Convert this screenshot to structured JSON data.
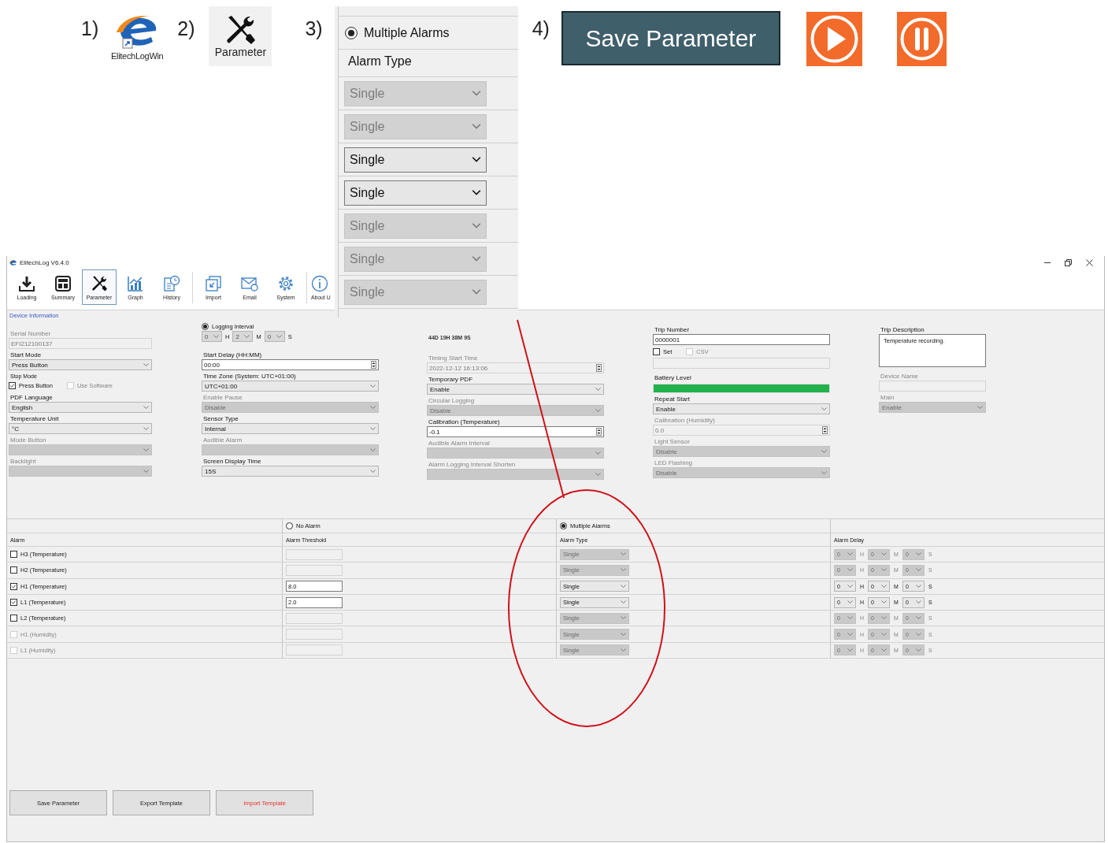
{
  "guide": {
    "steps": [
      {
        "number": "1)",
        "kind": "app",
        "caption": "ElitechLogWin"
      },
      {
        "number": "2)",
        "kind": "parameter",
        "caption": "Parameter"
      },
      {
        "number": "3)",
        "kind": "callout"
      },
      {
        "number": "4)",
        "kind": "buttons"
      }
    ],
    "callout": {
      "option": {
        "label": "Multiple Alarms",
        "selected": true
      },
      "header": "Alarm Type",
      "types": [
        {
          "value": "Single",
          "disabled": true
        },
        {
          "value": "Single",
          "disabled": true
        },
        {
          "value": "Single",
          "disabled": false
        },
        {
          "value": "Single",
          "disabled": false
        },
        {
          "value": "Single",
          "disabled": true
        },
        {
          "value": "Single",
          "disabled": true
        },
        {
          "value": "Single",
          "disabled": true
        }
      ]
    },
    "save_button": "Save Parameter",
    "media_buttons": [
      {
        "kind": "play"
      },
      {
        "kind": "pause"
      }
    ]
  },
  "window": {
    "title": "ElitechLog V6.4.0",
    "toolbar": [
      {
        "label": "Loading",
        "kind": "loading",
        "selected": false
      },
      {
        "label": "Summary",
        "kind": "summary",
        "selected": false
      },
      {
        "label": "Parameter",
        "kind": "parameter",
        "selected": true
      },
      {
        "label": "Graph",
        "kind": "graph",
        "selected": false
      },
      {
        "label": "History",
        "kind": "history",
        "selected": false
      },
      {
        "label": "Import",
        "kind": "import",
        "selected": false
      },
      {
        "label": "Email",
        "kind": "email",
        "selected": false
      },
      {
        "label": "System",
        "kind": "system",
        "selected": false
      },
      {
        "label": "About U",
        "kind": "about",
        "selected": false
      }
    ],
    "section": "Device Information",
    "columns": [
      [
        {
          "kind": "input",
          "label": "Serial Number",
          "value": "EFI212100137",
          "disabled": true
        },
        {
          "kind": "select",
          "label": "Start Mode",
          "value": "Press Button",
          "disabled": false
        },
        {
          "kind": "checks",
          "label": "Stop Mode",
          "items": [
            {
              "label": "Press Button",
              "checked": true,
              "disabled": false
            },
            {
              "label": "Use Software",
              "checked": false,
              "disabled": true
            }
          ]
        },
        {
          "kind": "select",
          "label": "PDF Language",
          "value": "English",
          "disabled": false
        },
        {
          "kind": "select",
          "label": "Temperature Unit",
          "value": "°C",
          "disabled": false
        },
        {
          "kind": "select",
          "label": "Mode Button",
          "disabled": true
        },
        {
          "kind": "select",
          "label": "Backlight",
          "disabled": true
        }
      ],
      [
        {
          "kind": "interval",
          "label": "Logging Interval",
          "selected": true,
          "parts": [
            {
              "value": "0",
              "unit": "H"
            },
            {
              "value": "2",
              "unit": "M"
            },
            {
              "value": "0",
              "unit": "S"
            }
          ]
        },
        {
          "kind": "spin",
          "label": "Start Delay (HH:MM)",
          "value": "00:00",
          "disabled": false
        },
        {
          "kind": "select",
          "label": "Time Zone (System: UTC+01:00)",
          "value": "UTC+01:00",
          "disabled": false
        },
        {
          "kind": "select",
          "label": "Enable Pause",
          "value": "Disable",
          "disabled": true
        },
        {
          "kind": "select",
          "label": "Sensor Type",
          "value": "Internal",
          "disabled": false
        },
        {
          "kind": "select",
          "label": "Audible Alarm",
          "disabled": true
        },
        {
          "kind": "select",
          "label": "Screen Display Time",
          "value": "15S",
          "disabled": false
        }
      ],
      [
        {
          "kind": "note",
          "value": "44D 19H 38M 9S"
        },
        {
          "kind": "spin",
          "label": "Timing Start Time",
          "value": "2022-12-12 16:13:06",
          "disabled": true
        },
        {
          "kind": "select",
          "label": "Temporary PDF",
          "value": "Enable",
          "disabled": false
        },
        {
          "kind": "select",
          "label": "Circular Logging",
          "value": "Disable",
          "disabled": true
        },
        {
          "kind": "spin",
          "label": "Calibration (Temperature)",
          "value": "-0.1",
          "disabled": false
        },
        {
          "kind": "select",
          "label": "Audible Alarm Interval",
          "disabled": true
        },
        {
          "kind": "select",
          "label": "Alarm Logging Interval Shorten",
          "disabled": true
        }
      ],
      [
        {
          "kind": "input",
          "label": "Trip Number",
          "value": "0000001",
          "disabled": false
        },
        {
          "kind": "checks",
          "items": [
            {
              "label": "Set",
              "checked": false,
              "disabled": false
            },
            {
              "label": "CSV",
              "checked": false,
              "disabled": true
            }
          ]
        },
        {
          "kind": "input",
          "disabled": true
        },
        {
          "kind": "battery",
          "label": "Battery Level",
          "level": 1
        },
        {
          "kind": "select",
          "label": "Repeat Start",
          "value": "Enable",
          "disabled": false
        },
        {
          "kind": "spin",
          "label": "Calibration (Humidity)",
          "value": "0.0",
          "disabled": true
        },
        {
          "kind": "select",
          "label": "Light Sensor",
          "value": "Disable",
          "disabled": true
        },
        {
          "kind": "select",
          "label": "LED Flashing",
          "value": "Disable",
          "disabled": true
        }
      ],
      [
        {
          "kind": "textarea",
          "label": "Trip Description",
          "value": "Temperature recording."
        },
        {
          "kind": "input",
          "label": "Device Name",
          "disabled": true
        },
        {
          "kind": "select",
          "label": "Main",
          "value": "Enable",
          "disabled": true
        }
      ]
    ],
    "alarms": {
      "modes": [
        {
          "label": "No Alarm",
          "selected": false
        },
        {
          "label": "Multiple Alarms",
          "selected": true
        }
      ],
      "columns": [
        "Alarm",
        "Alarm Threshold",
        "Alarm Type",
        "Alarm Delay"
      ],
      "rows": [
        {
          "name": "H3 (Temperature)",
          "checked": false,
          "disabled": false,
          "type": "Single",
          "delay": [
            {
              "value": "0",
              "unit": "H"
            },
            {
              "value": "0",
              "unit": "M"
            },
            {
              "value": "0",
              "unit": "S"
            }
          ]
        },
        {
          "name": "H2 (Temperature)",
          "checked": false,
          "disabled": false,
          "type": "Single",
          "delay": [
            {
              "value": "0",
              "unit": "H"
            },
            {
              "value": "0",
              "unit": "M"
            },
            {
              "value": "0",
              "unit": "S"
            }
          ]
        },
        {
          "name": "H1 (Temperature)",
          "checked": true,
          "disabled": false,
          "threshold": "8.0",
          "type": "Single",
          "delay": [
            {
              "value": "0",
              "unit": "H"
            },
            {
              "value": "0",
              "unit": "M"
            },
            {
              "value": "0",
              "unit": "S"
            }
          ]
        },
        {
          "name": "L1 (Temperature)",
          "checked": true,
          "disabled": false,
          "threshold": "2.0",
          "type": "Single",
          "delay": [
            {
              "value": "0",
              "unit": "H"
            },
            {
              "value": "0",
              "unit": "M"
            },
            {
              "value": "0",
              "unit": "S"
            }
          ]
        },
        {
          "name": "L2 (Temperature)",
          "checked": false,
          "disabled": false,
          "type": "Single",
          "delay": [
            {
              "value": "0",
              "unit": "H"
            },
            {
              "value": "0",
              "unit": "M"
            },
            {
              "value": "0",
              "unit": "S"
            }
          ]
        },
        {
          "name": "H1 (Humidity)",
          "checked": false,
          "disabled": true,
          "type": "Single",
          "delay": [
            {
              "value": "0",
              "unit": "H"
            },
            {
              "value": "0",
              "unit": "M"
            },
            {
              "value": "0",
              "unit": "S"
            }
          ]
        },
        {
          "name": "L1 (Humidity)",
          "checked": false,
          "disabled": true,
          "type": "Single",
          "delay": [
            {
              "value": "0",
              "unit": "H"
            },
            {
              "value": "0",
              "unit": "M"
            },
            {
              "value": "0",
              "unit": "S"
            }
          ]
        }
      ]
    },
    "buttons": [
      {
        "label": "Save Parameter",
        "accent": false
      },
      {
        "label": "Export Template",
        "accent": false
      },
      {
        "label": "Import Template",
        "accent": true
      }
    ]
  }
}
